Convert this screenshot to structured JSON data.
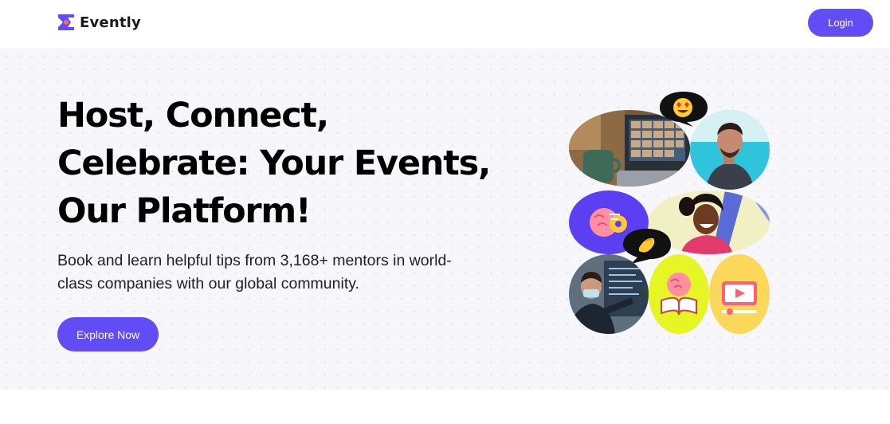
{
  "nav": {
    "brand": "Evently",
    "login_label": "Login"
  },
  "hero": {
    "title": "Host, Connect, Celebrate: Your Events, Our Platform!",
    "subtitle": "Book and learn helpful tips from 3,168+ mentors in world-class companies with our global community.",
    "cta_label": "Explore Now"
  },
  "colors": {
    "accent": "#624cf5",
    "hero_background": "#f6f6fb",
    "tile_purple": "#5b3ff0",
    "tile_lime": "#e6f524",
    "tile_yellow": "#fbd75a",
    "tile_cyan": "#2fc3dc"
  },
  "icons": {
    "logo": "evently-logo-icon",
    "heart_eyes": "heart-eyes-emoji-icon",
    "waving_hand": "waving-hand-emoji-icon",
    "brain_gear": "brain-gear-icon",
    "brain_book": "brain-book-icon",
    "video_player": "video-player-icon"
  }
}
